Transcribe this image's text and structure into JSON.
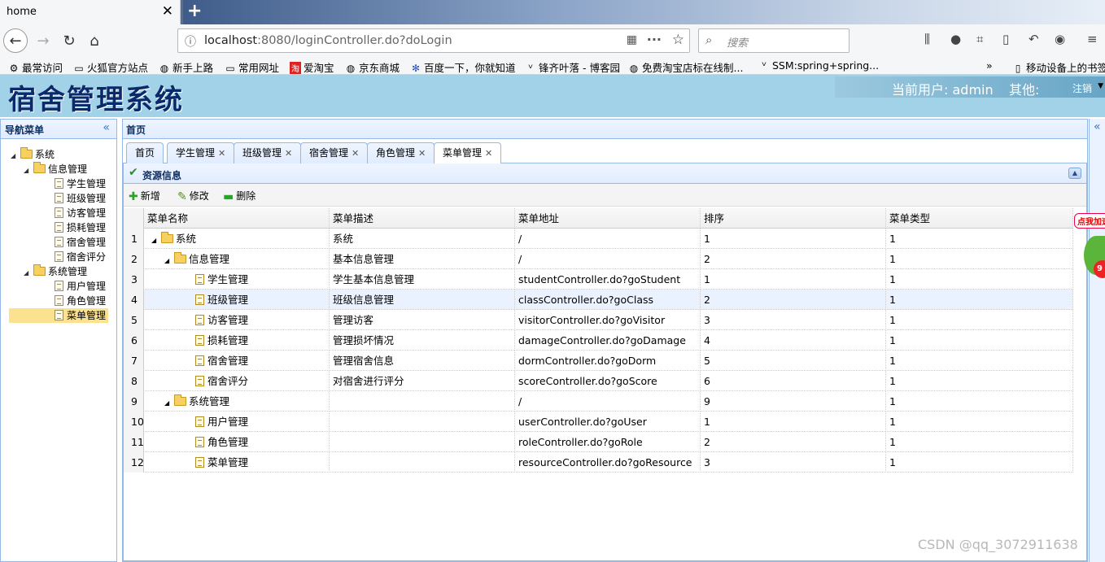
{
  "browser": {
    "tab_title": "home",
    "url_host": "localhost",
    "url_rest": ":8080/loginController.do?doLogin",
    "search_placeholder": "搜索",
    "bookmarks": [
      "最常访问",
      "火狐官方站点",
      "新手上路",
      "常用网址",
      "爱淘宝",
      "京东商城",
      "百度一下，你就知道",
      "锋齐叶落 - 博客园",
      "免费淘宝店标在线制...",
      "SSM:spring+spring...",
      "移动设备上的书签"
    ]
  },
  "app": {
    "title": "宿舍管理系统",
    "current_user_label": "当前用户: admin",
    "other_label": "其他:",
    "logout_label": "注销"
  },
  "nav": {
    "title": "导航菜单",
    "tree": [
      {
        "label": "系统",
        "level": 0,
        "type": "folder"
      },
      {
        "label": "信息管理",
        "level": 1,
        "type": "folder"
      },
      {
        "label": "学生管理",
        "level": 2,
        "type": "file"
      },
      {
        "label": "班级管理",
        "level": 2,
        "type": "file"
      },
      {
        "label": "访客管理",
        "level": 2,
        "type": "file"
      },
      {
        "label": "损耗管理",
        "level": 2,
        "type": "file"
      },
      {
        "label": "宿舍管理",
        "level": 2,
        "type": "file"
      },
      {
        "label": "宿舍评分",
        "level": 2,
        "type": "file"
      },
      {
        "label": "系统管理",
        "level": 1,
        "type": "folder"
      },
      {
        "label": "用户管理",
        "level": 2,
        "type": "file"
      },
      {
        "label": "角色管理",
        "level": 2,
        "type": "file"
      },
      {
        "label": "菜单管理",
        "level": 2,
        "type": "file",
        "selected": true
      }
    ]
  },
  "main": {
    "title": "首页",
    "tabs": [
      {
        "label": "首页",
        "closable": false
      },
      {
        "label": "学生管理",
        "closable": true
      },
      {
        "label": "班级管理",
        "closable": true
      },
      {
        "label": "宿舍管理",
        "closable": true
      },
      {
        "label": "角色管理",
        "closable": true
      },
      {
        "label": "菜单管理",
        "closable": true,
        "active": true
      }
    ],
    "resource_title": "资源信息",
    "toolbar": {
      "add": "新增",
      "edit": "修改",
      "delete": "删除"
    },
    "columns": [
      "菜单名称",
      "菜单描述",
      "菜单地址",
      "排序",
      "菜单类型"
    ],
    "rows": [
      {
        "n": "1",
        "name": "系统",
        "level": 0,
        "type": "folder",
        "desc": "系统",
        "url": "/",
        "sort": "1",
        "mtype": "1"
      },
      {
        "n": "2",
        "name": "信息管理",
        "level": 1,
        "type": "folder",
        "desc": "基本信息管理",
        "url": "/",
        "sort": "2",
        "mtype": "1"
      },
      {
        "n": "3",
        "name": "学生管理",
        "level": 2,
        "type": "file",
        "desc": "学生基本信息管理",
        "url": "studentController.do?goStudent",
        "sort": "1",
        "mtype": "1"
      },
      {
        "n": "4",
        "name": "班级管理",
        "level": 2,
        "type": "file",
        "desc": "班级信息管理",
        "url": "classController.do?goClass",
        "sort": "2",
        "mtype": "1",
        "highlight": true
      },
      {
        "n": "5",
        "name": "访客管理",
        "level": 2,
        "type": "file",
        "desc": "管理访客",
        "url": "visitorController.do?goVisitor",
        "sort": "3",
        "mtype": "1"
      },
      {
        "n": "6",
        "name": "损耗管理",
        "level": 2,
        "type": "file",
        "desc": "管理损坏情况",
        "url": "damageController.do?goDamage",
        "sort": "4",
        "mtype": "1"
      },
      {
        "n": "7",
        "name": "宿舍管理",
        "level": 2,
        "type": "file",
        "desc": "管理宿舍信息",
        "url": "dormController.do?goDorm",
        "sort": "5",
        "mtype": "1"
      },
      {
        "n": "8",
        "name": "宿舍评分",
        "level": 2,
        "type": "file",
        "desc": "对宿舍进行评分",
        "url": "scoreController.do?goScore",
        "sort": "6",
        "mtype": "1"
      },
      {
        "n": "9",
        "name": "系统管理",
        "level": 1,
        "type": "folder",
        "desc": "",
        "url": "/",
        "sort": "9",
        "mtype": "1"
      },
      {
        "n": "10",
        "name": "用户管理",
        "level": 2,
        "type": "file",
        "desc": "",
        "url": "userController.do?goUser",
        "sort": "1",
        "mtype": "1"
      },
      {
        "n": "11",
        "name": "角色管理",
        "level": 2,
        "type": "file",
        "desc": "",
        "url": "roleController.do?goRole",
        "sort": "2",
        "mtype": "1"
      },
      {
        "n": "12",
        "name": "菜单管理",
        "level": 2,
        "type": "file",
        "desc": "",
        "url": "resourceController.do?goResource",
        "sort": "3",
        "mtype": "1"
      }
    ]
  },
  "ad": {
    "label": "点我加速",
    "badge": "9"
  },
  "watermark": "CSDN @qq_3072911638"
}
